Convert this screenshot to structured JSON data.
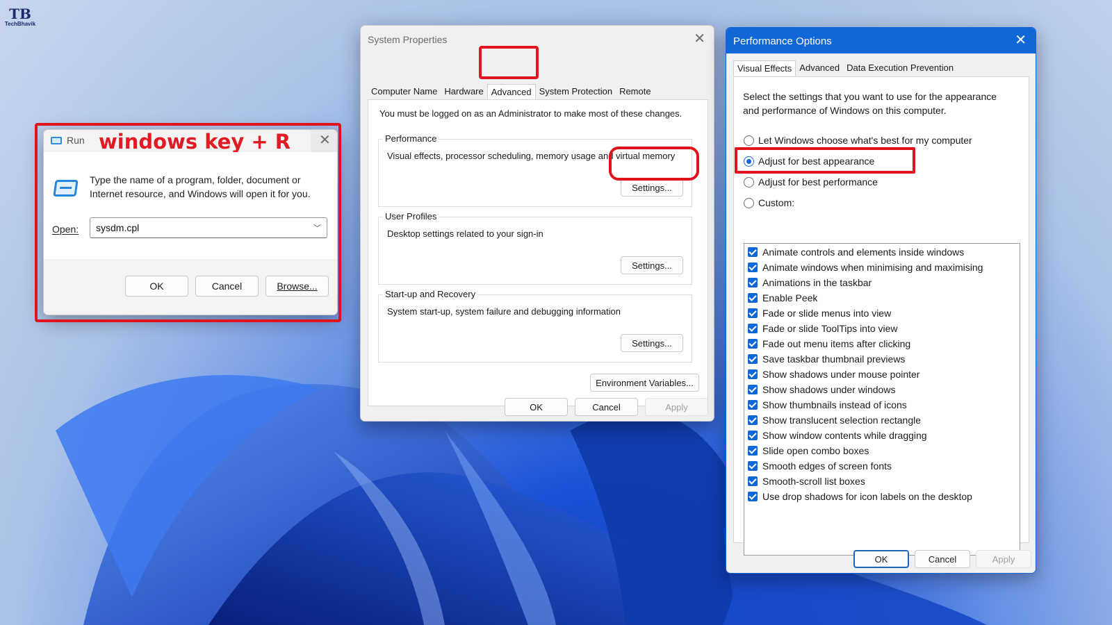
{
  "branding": {
    "logo_mark": "TB",
    "logo_text": "TechBhavik"
  },
  "run_dialog": {
    "title": "Run",
    "annotation": "windows key + R",
    "description": "Type the name of a program, folder, document or Internet resource, and Windows will open it for you.",
    "open_label": "Open:",
    "open_value": "sysdm.cpl",
    "ok_label": "OK",
    "cancel_label": "Cancel",
    "browse_label": "Browse..."
  },
  "system_properties": {
    "title": "System Properties",
    "tabs": [
      "Computer Name",
      "Hardware",
      "Advanced",
      "System Protection",
      "Remote"
    ],
    "active_tab": "Advanced",
    "admin_note": "You must be logged on as an Administrator to make most of these changes.",
    "groups": [
      {
        "title": "Performance",
        "description": "Visual effects, processor scheduling, memory usage and virtual memory",
        "button": "Settings..."
      },
      {
        "title": "User Profiles",
        "description": "Desktop settings related to your sign-in",
        "button": "Settings..."
      },
      {
        "title": "Start-up and Recovery",
        "description": "System start-up, system failure and debugging information",
        "button": "Settings..."
      }
    ],
    "env_button": "Environment Variables...",
    "ok_label": "OK",
    "cancel_label": "Cancel",
    "apply_label": "Apply"
  },
  "performance_options": {
    "title": "Performance Options",
    "tabs": [
      "Visual Effects",
      "Advanced",
      "Data Execution Prevention"
    ],
    "active_tab": "Visual Effects",
    "intro": "Select the settings that you want to use for the appearance and performance of Windows on this computer.",
    "radios": [
      {
        "label": "Let Windows choose what's best for my computer",
        "checked": false
      },
      {
        "label": "Adjust for best appearance",
        "checked": true
      },
      {
        "label": "Adjust for best performance",
        "checked": false
      },
      {
        "label": "Custom:",
        "checked": false
      }
    ],
    "effects": [
      "Animate controls and elements inside windows",
      "Animate windows when minimising and maximising",
      "Animations in the taskbar",
      "Enable Peek",
      "Fade or slide menus into view",
      "Fade or slide ToolTips into view",
      "Fade out menu items after clicking",
      "Save taskbar thumbnail previews",
      "Show shadows under mouse pointer",
      "Show shadows under windows",
      "Show thumbnails instead of icons",
      "Show translucent selection rectangle",
      "Show window contents while dragging",
      "Slide open combo boxes",
      "Smooth edges of screen fonts",
      "Smooth-scroll list boxes",
      "Use drop shadows for icon labels on the desktop"
    ],
    "ok_label": "OK",
    "cancel_label": "Cancel",
    "apply_label": "Apply"
  },
  "colors": {
    "accent": "#1167d6",
    "highlight_red": "#e0141e",
    "wallpaper_blue": "#1a52d8"
  }
}
